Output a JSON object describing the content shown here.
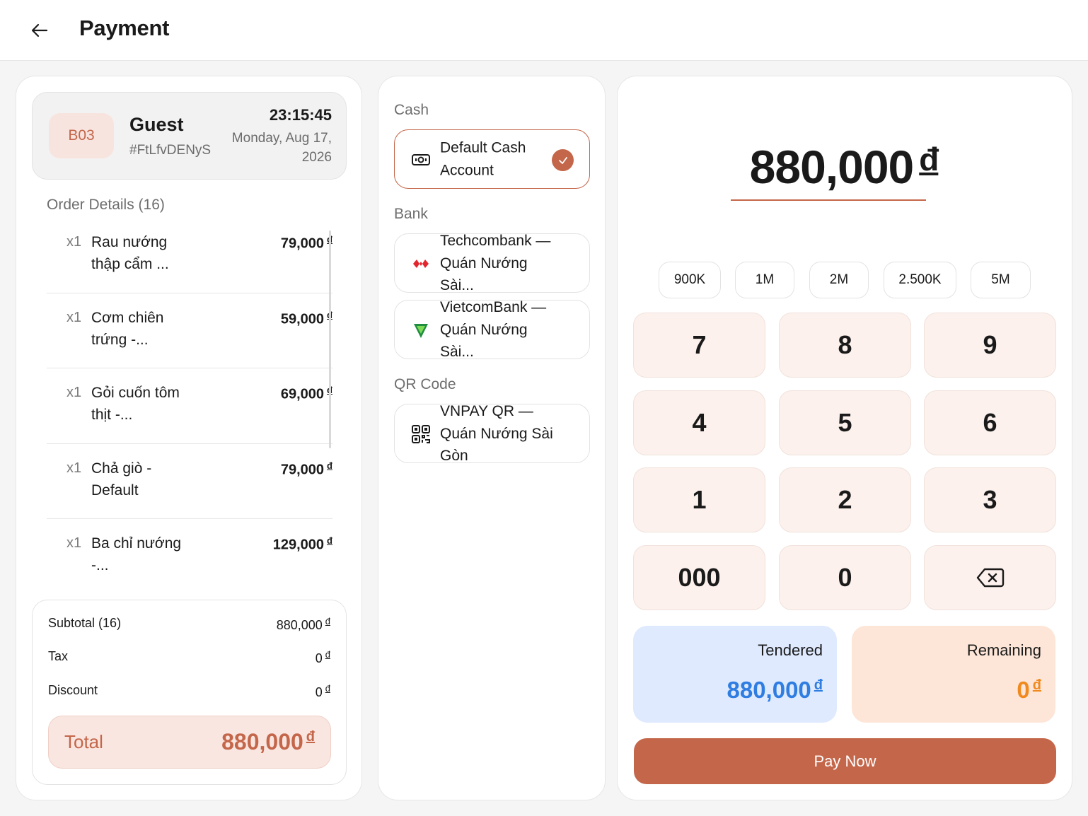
{
  "header": {
    "title": "Payment"
  },
  "guest": {
    "table": "B03",
    "name": "Guest",
    "id": "#FtLfvDENyS",
    "time": "23:15:45",
    "date": "Monday, Aug 17, 2026"
  },
  "order": {
    "title": "Order Details (16)",
    "items": [
      {
        "qty": "x1",
        "name": "Rau nướng thập cẩm ...",
        "price": "79,000",
        "currency": "đ"
      },
      {
        "qty": "x1",
        "name": "Cơm chiên trứng -...",
        "price": "59,000",
        "currency": "đ"
      },
      {
        "qty": "x1",
        "name": "Gỏi cuốn tôm thịt -...",
        "price": "69,000",
        "currency": "đ"
      },
      {
        "qty": "x1",
        "name": "Chả giò - Default",
        "price": "79,000",
        "currency": "đ"
      },
      {
        "qty": "x1",
        "name": "Ba chỉ nướng -...",
        "price": "129,000",
        "currency": "đ"
      }
    ]
  },
  "summary": {
    "subtotal_label": "Subtotal (16)",
    "subtotal_value": "880,000",
    "tax_label": "Tax",
    "tax_value": "0",
    "discount_label": "Discount",
    "discount_value": "0",
    "total_label": "Total",
    "total_value": "880,000",
    "currency": "đ"
  },
  "methods": {
    "cash_label": "Cash",
    "cash_account": "Default Cash Account",
    "bank_label": "Bank",
    "bank1": "Techcombank — Quán Nướng Sài...",
    "bank2": "VietcomBank — Quán Nướng Sài...",
    "qr_label": "QR Code",
    "qr1": "VNPAY QR — Quán Nướng Sài Gòn"
  },
  "keypad": {
    "amount": "880,000",
    "currency": "đ",
    "chips": [
      "900K",
      "1M",
      "2M",
      "2.500K",
      "5M"
    ],
    "keys": [
      "7",
      "8",
      "9",
      "4",
      "5",
      "6",
      "1",
      "2",
      "3",
      "000",
      "0"
    ]
  },
  "totals": {
    "tendered_label": "Tendered",
    "tendered_value": "880,000",
    "remaining_label": "Remaining",
    "remaining_value": "0",
    "currency": "đ"
  },
  "pay_button": "Pay Now",
  "colors": {
    "accent": "#c4664a",
    "tendered": "#2f7de1",
    "remaining": "#f08a1f"
  }
}
